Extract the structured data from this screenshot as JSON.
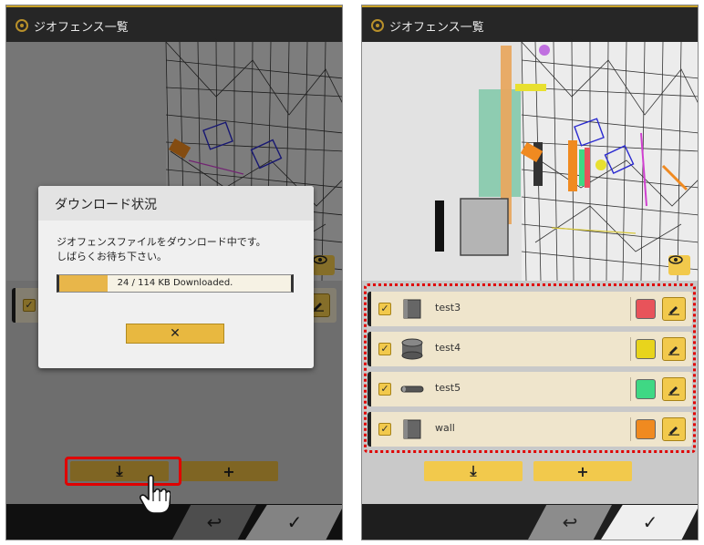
{
  "left_screen": {
    "title": "ジオフェンス一覧",
    "dialog": {
      "title": "ダウンロード状況",
      "message_line1": "ジオフェンスファイルをダウンロード中です。",
      "message_line2": "しばらくお待ち下さい。",
      "progress_text": "24 / 114 KB Downloaded.",
      "progress_fraction": 0.21,
      "close_label": "✕"
    },
    "download_label": "⤓",
    "add_label": "+",
    "back_label": "↩",
    "ok_label": "✓"
  },
  "right_screen": {
    "title": "ジオフェンス一覧",
    "items": [
      {
        "label": "test3",
        "shape": "box",
        "color": "#e8535a"
      },
      {
        "label": "test4",
        "shape": "cylinder",
        "color": "#e8d41c"
      },
      {
        "label": "test5",
        "shape": "capsule",
        "color": "#3fd884"
      },
      {
        "label": "wall",
        "shape": "box",
        "color": "#f08a20"
      }
    ],
    "download_label": "⤓",
    "add_label": "+",
    "back_label": "↩",
    "ok_label": "✓"
  },
  "colors": {
    "accent": "#f2c94c",
    "highlight": "#e00000"
  }
}
